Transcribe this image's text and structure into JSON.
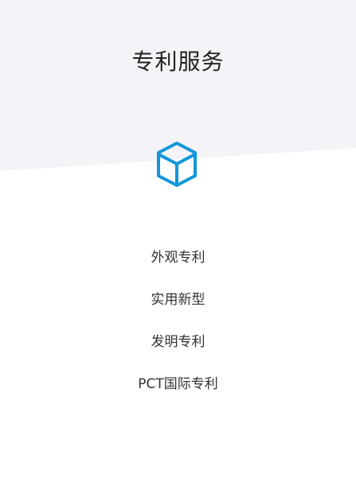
{
  "page": {
    "title": "专利服务"
  },
  "icon": {
    "name": "cube-icon",
    "color": "#1296db"
  },
  "colors": {
    "header_background": "#f3f3f8",
    "background": "#ffffff"
  },
  "services": [
    {
      "label": "外观专利"
    },
    {
      "label": "实用新型"
    },
    {
      "label": "发明专利"
    },
    {
      "label": "PCT国际专利"
    }
  ]
}
